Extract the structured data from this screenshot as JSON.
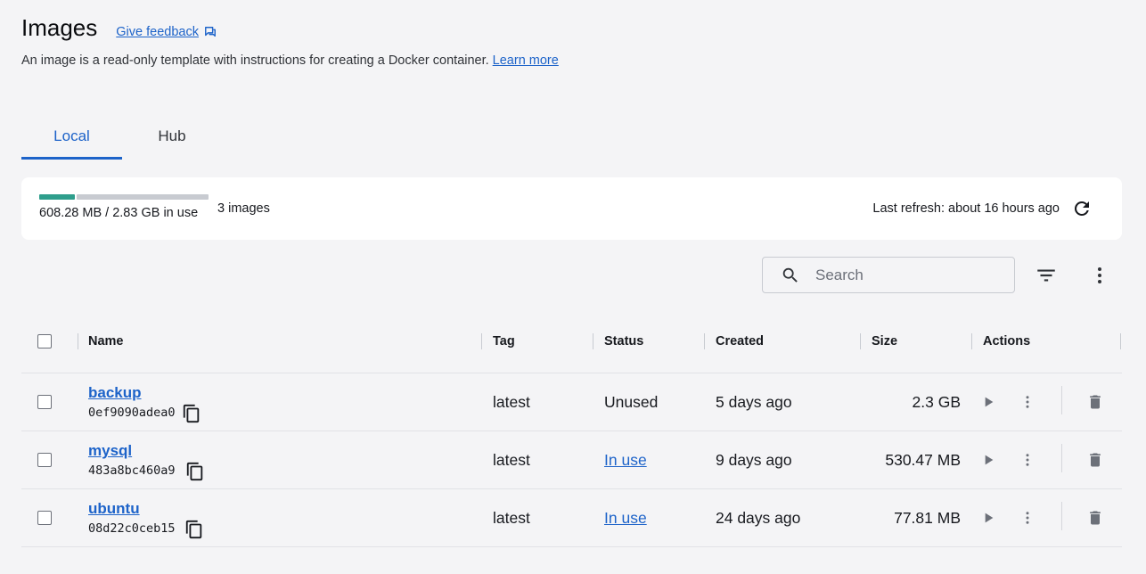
{
  "header": {
    "title": "Images",
    "feedback_label": "Give feedback",
    "subtitle": "An image is a read-only template with instructions for creating a Docker container.",
    "learn_more": "Learn more"
  },
  "tabs": [
    {
      "label": "Local",
      "active": true
    },
    {
      "label": "Hub",
      "active": false
    }
  ],
  "usage": {
    "text": "608.28 MB / 2.83 GB in use",
    "used_fraction": 0.21,
    "image_count": "3 images",
    "last_refresh": "Last refresh: about 16 hours ago"
  },
  "search": {
    "placeholder": "Search",
    "value": ""
  },
  "table": {
    "columns": [
      "Name",
      "Tag",
      "Status",
      "Created",
      "Size",
      "Actions"
    ],
    "rows": [
      {
        "name": "backup",
        "id": "0ef9090adea0",
        "tag": "latest",
        "status": "Unused",
        "status_link": false,
        "created": "5 days ago",
        "size": "2.3 GB"
      },
      {
        "name": "mysql",
        "id": "483a8bc460a9",
        "tag": "latest",
        "status": "In use",
        "status_link": true,
        "created": "9 days ago",
        "size": "530.47 MB"
      },
      {
        "name": "ubuntu",
        "id": "08d22c0ceb15",
        "tag": "latest",
        "status": "In use",
        "status_link": true,
        "created": "24 days ago",
        "size": "77.81 MB"
      }
    ]
  },
  "icons": {
    "feedback": "feedback-icon",
    "refresh": "refresh-icon",
    "search": "search-icon",
    "filter": "filter-icon",
    "more": "more-vertical-icon",
    "copy": "copy-icon",
    "run": "play-icon",
    "delete": "trash-icon"
  },
  "colors": {
    "accent": "#1d63c9",
    "usage_used": "#2e9e8c",
    "usage_free": "#c8cbd1",
    "background": "#f4f4f6"
  }
}
